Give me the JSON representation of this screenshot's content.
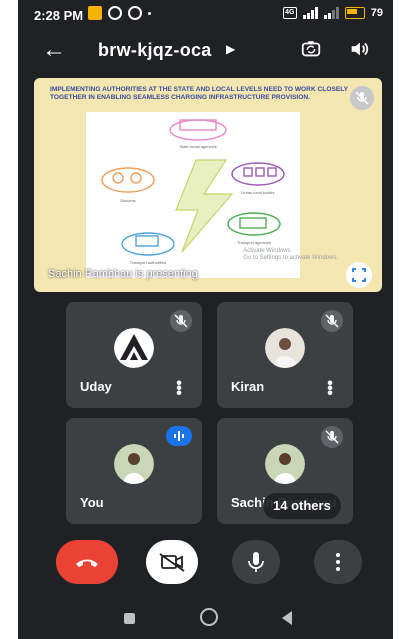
{
  "status_bar": {
    "time": "2:28 PM",
    "network_type": "4G",
    "battery": "79"
  },
  "header": {
    "meeting_code": "brw-kjqz-oca",
    "back_icon": "arrow-left-icon",
    "switch_camera_icon": "switch-camera-icon",
    "speaker_icon": "speaker-icon"
  },
  "presentation": {
    "slide_heading": "Implementing authorities at the state and local levels need to work closely together in enabling seamless charging infrastructure provision.",
    "watermark_line1": "Activate Windows",
    "watermark_line2": "Go to Settings to activate Windows.",
    "presenter_label": "Sachin Rambhau is presenting",
    "figure_labels": {
      "top": "State nodal agencies",
      "left": "Discoms",
      "right": "Urban local bodies",
      "bottom_left": "Transport authorities",
      "bottom_right": "Transport agencies"
    }
  },
  "participants": [
    {
      "name": "Uday",
      "muted": true
    },
    {
      "name": "Kiran",
      "muted": true
    },
    {
      "name": "You",
      "muted": false,
      "speaking": true
    },
    {
      "name": "Sachin Rambhau",
      "muted": true
    }
  ],
  "others_label": "14 others",
  "colors": {
    "background": "#202124",
    "tile": "#3c4043",
    "end_call": "#ea4335",
    "speaking": "#1a73e8",
    "slide_bg": "#f4e6b0",
    "slide_heading": "#3a4a9c"
  }
}
